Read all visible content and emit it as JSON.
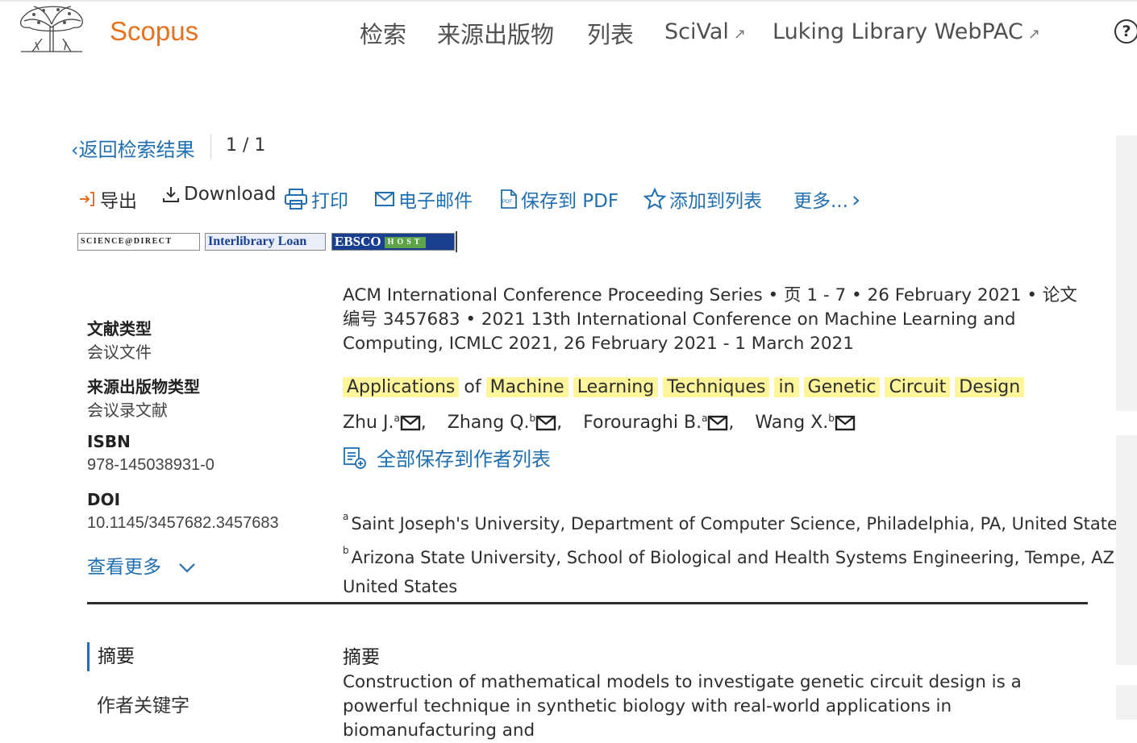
{
  "header": {
    "brand": "Scopus",
    "nav": [
      {
        "label": "检索"
      },
      {
        "label": "来源出版物"
      },
      {
        "label": "列表"
      },
      {
        "label": "SciVal",
        "ext": "↗"
      },
      {
        "label": "Luking Library WebPAC",
        "ext": "↗"
      }
    ],
    "help": "?"
  },
  "back": {
    "label": "返回检索结果",
    "pager": "1 / 1"
  },
  "actions": {
    "export": "导出",
    "download": "Download",
    "print": "打印",
    "email": "电子邮件",
    "save_pdf": "保存到 PDF",
    "add_list": "添加到列表",
    "more": "更多..."
  },
  "partners": {
    "sciencedirect": "SCIENCE@DIRECT",
    "ill": "Interlibrary Loan",
    "ebsco": "EBSCO",
    "ebsco_host": "HOST"
  },
  "meta": {
    "doc_type_label": "文献类型",
    "doc_type_value": "会议文件",
    "source_type_label": "来源出版物类型",
    "source_type_value": "会议录文献",
    "isbn_label": "ISBN",
    "isbn_value": "978-145038931-0",
    "doi_label": "DOI",
    "doi_value": "10.1145/3457682.3457683",
    "more": "查看更多"
  },
  "source_line": "ACM International Conference Proceeding Series • 页 1 - 7 • 26 February 2021 • 论文编号 3457683 • 2021 13th International Conference on Machine Learning and Computing, ICMLC 2021, 26 February 2021 - 1 March 2021",
  "title_words": [
    {
      "w": "Applications",
      "hl": true
    },
    {
      "w": "of",
      "hl": false
    },
    {
      "w": "Machine",
      "hl": true
    },
    {
      "w": "Learning",
      "hl": true
    },
    {
      "w": "Techniques",
      "hl": true
    },
    {
      "w": "in",
      "hl": true
    },
    {
      "w": "Genetic",
      "hl": true
    },
    {
      "w": "Circuit",
      "hl": true
    },
    {
      "w": "Design",
      "hl": true
    }
  ],
  "authors": [
    {
      "name": "Zhu J.",
      "sup": "a",
      "sep": ","
    },
    {
      "name": "Zhang Q.",
      "sup": "b",
      "sep": ","
    },
    {
      "name": "Forouraghi B.",
      "sup": "a",
      "sep": ","
    },
    {
      "name": "Wang X.",
      "sup": "b",
      "sep": ""
    }
  ],
  "save_all_authors": "全部保存到作者列表",
  "affiliations": {
    "a_sup": "a",
    "a": "Saint Joseph's University, Department of Computer Science, Philadelphia, PA, United States",
    "b_sup": "b",
    "b_line1": "Arizona State University, School of Biological and Health Systems Engineering, Tempe, AZ,",
    "b_line2": "United States"
  },
  "tabs": {
    "abstract": "摘要",
    "keywords": "作者关键字"
  },
  "abstract": {
    "heading": "摘要",
    "text": "Construction of mathematical models to investigate genetic circuit design is a powerful technique in synthetic biology with real-world applications in biomanufacturing and"
  },
  "colors": {
    "brand": "#e9711c",
    "link": "#1f6fb2",
    "highlight": "#fff59a"
  }
}
